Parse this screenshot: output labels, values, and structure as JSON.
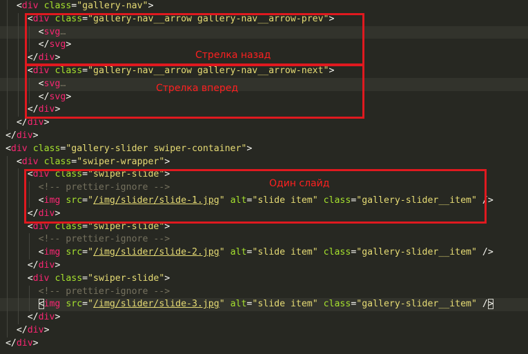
{
  "editor": {
    "lines": [
      [
        [
          "ws",
          "  "
        ],
        [
          "p",
          "<"
        ],
        [
          "t",
          "div"
        ],
        [
          "p",
          " "
        ],
        [
          "a",
          "class"
        ],
        [
          "p",
          "="
        ],
        [
          "s",
          "\"gallery-nav\""
        ],
        [
          "p",
          ">"
        ]
      ],
      [
        [
          "ws",
          "    "
        ],
        [
          "p",
          "<"
        ],
        [
          "t",
          "div"
        ],
        [
          "p",
          " "
        ],
        [
          "a",
          "class"
        ],
        [
          "p",
          "="
        ],
        [
          "s",
          "\"gallery-nav__arrow gallery-nav__arrow-prev\""
        ],
        [
          "p",
          ">"
        ]
      ],
      [
        [
          "ws",
          "      "
        ],
        [
          "p",
          "<"
        ],
        [
          "t",
          "svg"
        ],
        [
          "f",
          "…"
        ]
      ],
      [
        [
          "ws",
          "      "
        ],
        [
          "p",
          "</"
        ],
        [
          "t",
          "svg"
        ],
        [
          "p",
          ">"
        ]
      ],
      [
        [
          "ws",
          "    "
        ],
        [
          "p",
          "</"
        ],
        [
          "t",
          "div"
        ],
        [
          "p",
          ">"
        ]
      ],
      [
        [
          "ws",
          "    "
        ],
        [
          "p",
          "<"
        ],
        [
          "t",
          "div"
        ],
        [
          "p",
          " "
        ],
        [
          "a",
          "class"
        ],
        [
          "p",
          "="
        ],
        [
          "s",
          "\"gallery-nav__arrow gallery-nav__arrow-next\""
        ],
        [
          "p",
          ">"
        ]
      ],
      [
        [
          "ws",
          "      "
        ],
        [
          "p",
          "<"
        ],
        [
          "t",
          "svg"
        ],
        [
          "f",
          "…"
        ]
      ],
      [
        [
          "ws",
          "      "
        ],
        [
          "p",
          "</"
        ],
        [
          "t",
          "svg"
        ],
        [
          "p",
          ">"
        ]
      ],
      [
        [
          "ws",
          "    "
        ],
        [
          "p",
          "</"
        ],
        [
          "t",
          "div"
        ],
        [
          "p",
          ">"
        ]
      ],
      [
        [
          "ws",
          "  "
        ],
        [
          "p",
          "</"
        ],
        [
          "t",
          "div"
        ],
        [
          "p",
          ">"
        ]
      ],
      [
        [
          "p",
          "</"
        ],
        [
          "t",
          "div"
        ],
        [
          "p",
          ">"
        ]
      ],
      [
        [
          "p",
          "<"
        ],
        [
          "t",
          "div"
        ],
        [
          "p",
          " "
        ],
        [
          "a",
          "class"
        ],
        [
          "p",
          "="
        ],
        [
          "s",
          "\"gallery-slider swiper-container\""
        ],
        [
          "p",
          ">"
        ]
      ],
      [
        [
          "ws",
          "  "
        ],
        [
          "p",
          "<"
        ],
        [
          "t",
          "div"
        ],
        [
          "p",
          " "
        ],
        [
          "a",
          "class"
        ],
        [
          "p",
          "="
        ],
        [
          "s",
          "\"swiper-wrapper\""
        ],
        [
          "p",
          ">"
        ]
      ],
      [
        [
          "ws",
          "    "
        ],
        [
          "p",
          "<"
        ],
        [
          "t",
          "div"
        ],
        [
          "p",
          " "
        ],
        [
          "a",
          "class"
        ],
        [
          "p",
          "="
        ],
        [
          "s",
          "\"swiper-slide\""
        ],
        [
          "p",
          ">"
        ]
      ],
      [
        [
          "ws",
          "      "
        ],
        [
          "c",
          "<!-- prettier-ignore -->"
        ]
      ],
      [
        [
          "ws",
          "      "
        ],
        [
          "p",
          "<"
        ],
        [
          "t",
          "img"
        ],
        [
          "p",
          " "
        ],
        [
          "a",
          "src"
        ],
        [
          "p",
          "="
        ],
        [
          "s",
          "\""
        ],
        [
          "su",
          "/img/slider/slide-1.jpg"
        ],
        [
          "s",
          "\""
        ],
        [
          "p",
          " "
        ],
        [
          "a",
          "alt"
        ],
        [
          "p",
          "="
        ],
        [
          "s",
          "\"slide item\""
        ],
        [
          "p",
          " "
        ],
        [
          "a",
          "class"
        ],
        [
          "p",
          "="
        ],
        [
          "s",
          "\"gallery-slider__item\""
        ],
        [
          "p",
          " />"
        ]
      ],
      [
        [
          "ws",
          "    "
        ],
        [
          "p",
          "</"
        ],
        [
          "t",
          "div"
        ],
        [
          "p",
          ">"
        ]
      ],
      [
        [
          "ws",
          "    "
        ],
        [
          "p",
          "<"
        ],
        [
          "t",
          "div"
        ],
        [
          "p",
          " "
        ],
        [
          "a",
          "class"
        ],
        [
          "p",
          "="
        ],
        [
          "s",
          "\"swiper-slide\""
        ],
        [
          "p",
          ">"
        ]
      ],
      [
        [
          "ws",
          "      "
        ],
        [
          "c",
          "<!-- prettier-ignore -->"
        ]
      ],
      [
        [
          "ws",
          "      "
        ],
        [
          "p",
          "<"
        ],
        [
          "t",
          "img"
        ],
        [
          "p",
          " "
        ],
        [
          "a",
          "src"
        ],
        [
          "p",
          "="
        ],
        [
          "s",
          "\""
        ],
        [
          "su",
          "/img/slider/slide-2.jpg"
        ],
        [
          "s",
          "\""
        ],
        [
          "p",
          " "
        ],
        [
          "a",
          "alt"
        ],
        [
          "p",
          "="
        ],
        [
          "s",
          "\"slide item\""
        ],
        [
          "p",
          " "
        ],
        [
          "a",
          "class"
        ],
        [
          "p",
          "="
        ],
        [
          "s",
          "\"gallery-slider__item\""
        ],
        [
          "p",
          " />"
        ]
      ],
      [
        [
          "ws",
          "    "
        ],
        [
          "p",
          "</"
        ],
        [
          "t",
          "div"
        ],
        [
          "p",
          ">"
        ]
      ],
      [
        [
          "ws",
          "    "
        ],
        [
          "p",
          "<"
        ],
        [
          "t",
          "div"
        ],
        [
          "p",
          " "
        ],
        [
          "a",
          "class"
        ],
        [
          "p",
          "="
        ],
        [
          "s",
          "\"swiper-slide\""
        ],
        [
          "p",
          ">"
        ]
      ],
      [
        [
          "ws",
          "      "
        ],
        [
          "c",
          "<!-- prettier-ignore -->"
        ]
      ],
      [
        [
          "ws",
          "      "
        ],
        [
          "pb",
          "<"
        ],
        [
          "t",
          "img"
        ],
        [
          "p",
          " "
        ],
        [
          "a",
          "src"
        ],
        [
          "p",
          "="
        ],
        [
          "s",
          "\""
        ],
        [
          "su",
          "/img/slider/slide-3.jpg"
        ],
        [
          "s",
          "\""
        ],
        [
          "p",
          " "
        ],
        [
          "a",
          "alt"
        ],
        [
          "p",
          "="
        ],
        [
          "s",
          "\"slide item\""
        ],
        [
          "p",
          " "
        ],
        [
          "a",
          "class"
        ],
        [
          "p",
          "="
        ],
        [
          "s",
          "\"gallery-slider__item\""
        ],
        [
          "p",
          " /"
        ],
        [
          "pb",
          ">"
        ]
      ],
      [
        [
          "ws",
          "    "
        ],
        [
          "p",
          "</"
        ],
        [
          "t",
          "div"
        ],
        [
          "p",
          ">"
        ]
      ],
      [
        [
          "ws",
          "  "
        ],
        [
          "p",
          "</"
        ],
        [
          "t",
          "div"
        ],
        [
          "p",
          ">"
        ]
      ],
      [
        [
          "p",
          "</"
        ],
        [
          "t",
          "div"
        ],
        [
          "p",
          ">"
        ]
      ]
    ]
  },
  "colors": {
    "background": "#272822",
    "tag": "#f92672",
    "attribute": "#a6e22e",
    "string": "#e6db74",
    "comment": "#75715e",
    "punctuation": "#f8f8f2",
    "annotation": "#e0191f"
  },
  "annotations": {
    "back_arrow_label": "Стрелка назад",
    "forward_arrow_label": "Стрелка вперед",
    "single_slide_label": "Один слайд"
  }
}
